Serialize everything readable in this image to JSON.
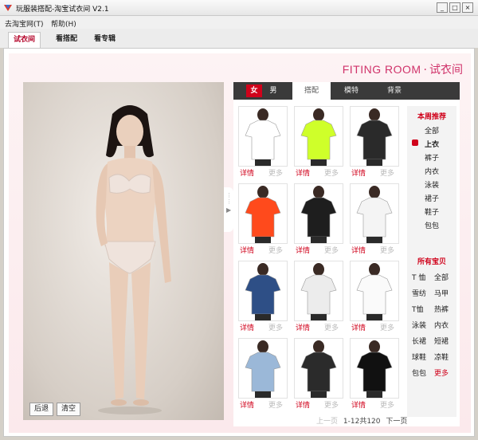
{
  "window": {
    "title": "玩服装搭配-淘宝试衣间 V2.1",
    "minimize": "_",
    "maximize": "□",
    "close": "×"
  },
  "menu": [
    "去淘宝网(T)",
    "帮助(H)"
  ],
  "tabs": [
    {
      "label": "试衣间",
      "active": true
    },
    {
      "label": "看搭配",
      "active": false
    },
    {
      "label": "看专辑",
      "active": false
    }
  ],
  "brand": {
    "en": "FITING ROOM",
    "sep": "·",
    "cn": "试衣间"
  },
  "model_controls": {
    "back": "后退",
    "clear": "清空"
  },
  "panel": {
    "gender": [
      {
        "label": "女",
        "active": true
      },
      {
        "label": "男",
        "active": false
      }
    ],
    "categories": [
      {
        "label": "搭配",
        "active": true
      },
      {
        "label": "模特",
        "active": false
      },
      {
        "label": "背景",
        "active": false
      }
    ],
    "item_actions": {
      "detail": "详情",
      "more": "更多"
    },
    "products": [
      {
        "icon": "tshirt-lips-icon",
        "bg": "#ffffff",
        "main": "#ffffff"
      },
      {
        "icon": "tshirt-neon-icon",
        "bg": "#ffffff",
        "main": "#cfff2a"
      },
      {
        "icon": "top-striped-icon",
        "bg": "#ffffff",
        "main": "#2a2a2a"
      },
      {
        "icon": "tank-orange-icon",
        "bg": "#ffffff",
        "main": "#ff4a1c"
      },
      {
        "icon": "tshirt-moschino-icon",
        "bg": "#ffffff",
        "main": "#1e1e1e"
      },
      {
        "icon": "tshirt-print-icon",
        "bg": "#ffffff",
        "main": "#f4f4f4"
      },
      {
        "icon": "shirt-denim-icon",
        "bg": "#ffffff",
        "main": "#2e4f86"
      },
      {
        "icon": "tshirt-graphic-icon",
        "bg": "#ffffff",
        "main": "#ececec"
      },
      {
        "icon": "blouse-white-icon",
        "bg": "#ffffff",
        "main": "#fafafa"
      },
      {
        "icon": "jacket-denim-icon",
        "bg": "#ffffff",
        "main": "#9bb8d8"
      },
      {
        "icon": "top-sequin-icon",
        "bg": "#ffffff",
        "main": "#2b2b2b"
      },
      {
        "icon": "tshirt-poster-icon",
        "bg": "#ffffff",
        "main": "#111111"
      }
    ],
    "pager": {
      "prev": "上一页",
      "info": "1-12共120",
      "next": "下一页"
    }
  },
  "sidebar": {
    "weekly_title": "本周推荐",
    "weekly": [
      "全部",
      "上衣",
      "裤子",
      "内衣",
      "泳装",
      "裙子",
      "鞋子",
      "包包"
    ],
    "weekly_selected": "上衣",
    "all_title": "所有宝贝",
    "all_rows": [
      [
        "T 恤",
        "全部"
      ],
      [
        "雪纺",
        "马甲"
      ],
      [
        "T恤",
        "热裤"
      ],
      [
        "泳装",
        "内衣"
      ],
      [
        "长裙",
        "短裙"
      ],
      [
        "球鞋",
        "凉鞋"
      ],
      [
        "包包",
        "更多"
      ]
    ]
  },
  "colors": {
    "accent": "#d0021b",
    "brand": "#d0326a",
    "tab_bar": "#3a3a3a"
  }
}
